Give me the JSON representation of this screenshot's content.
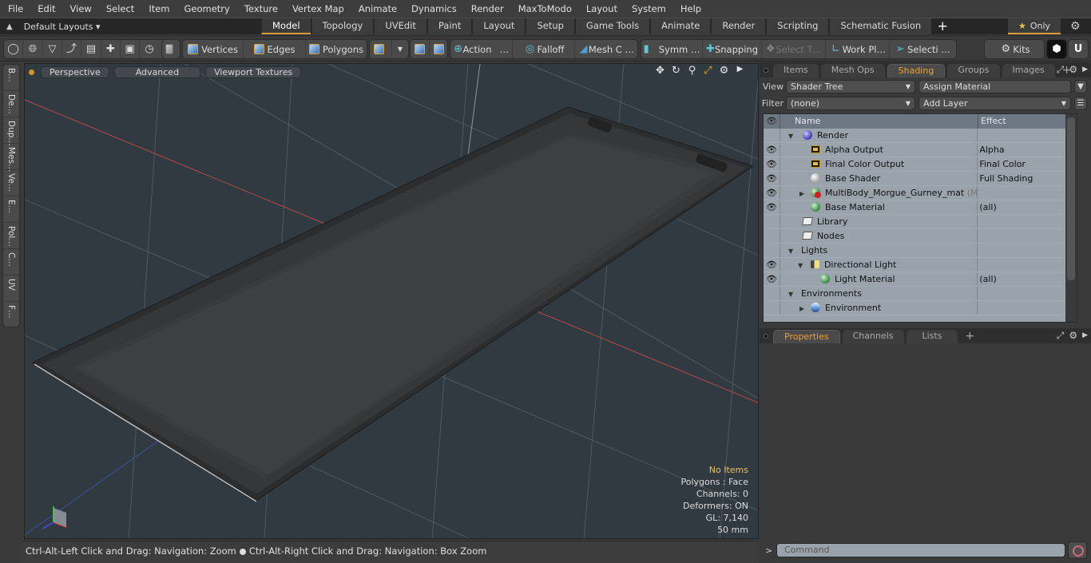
{
  "menu": [
    "File",
    "Edit",
    "View",
    "Select",
    "Item",
    "Geometry",
    "Texture",
    "Vertex Map",
    "Animate",
    "Dynamics",
    "Render",
    "MaxToModo",
    "Layout",
    "System",
    "Help"
  ],
  "layouts": {
    "label": "Default Layouts ▾",
    "tabs": [
      "Model",
      "Topology",
      "UVEdit",
      "Paint",
      "Layout",
      "Setup",
      "Game Tools",
      "Animate",
      "Render",
      "Scripting",
      "Schematic Fusion"
    ],
    "active_tab": "Model",
    "add_label": "+",
    "only_label": "Only"
  },
  "toolbar": {
    "vertices": "Vertices",
    "edges": "Edges",
    "polygons": "Polygons",
    "action": "Action",
    "falloff": "Falloff",
    "mesh_c": "Mesh C …",
    "symm": "Symm …",
    "snapping": "Snapping",
    "select_t": "Select T…",
    "work_pl": "Work Pl…",
    "selecti": "Selecti …",
    "kits": "Kits",
    "ellipsis": "…"
  },
  "left_tools": [
    "B…",
    "De…",
    "Dup…",
    "Mes…",
    "Ve…",
    "E…",
    "Pol…",
    "C…",
    "UV",
    "F…"
  ],
  "viewport": {
    "buttons": [
      "Perspective",
      "Advanced",
      "Viewport Textures"
    ],
    "info": {
      "items": "No Items",
      "polygons": "Polygons : Face",
      "channels": "Channels: 0",
      "deformers": "Deformers: ON",
      "gl": "GL: 7,140",
      "scale": "50 mm"
    }
  },
  "status": {
    "left": "Ctrl-Alt-Left Click and Drag: Navigation: Zoom",
    "right": "Ctrl-Alt-Right Click and Drag: Navigation: Box Zoom"
  },
  "top_panel": {
    "tabs": [
      "Items",
      "Mesh Ops",
      "Shading",
      "Groups",
      "Images"
    ],
    "active_tab": "Shading",
    "view_label": "View",
    "view_value": "Shader Tree",
    "assign_material": "Assign Material",
    "filter_label": "Filter",
    "filter_value": "(none)",
    "add_layer": "Add Layer",
    "columns": {
      "name": "Name",
      "effect": "Effect"
    },
    "rows": [
      {
        "name": "Render",
        "effect": "",
        "eye": false,
        "icon": "render-sphere-icon"
      },
      {
        "name": "Alpha Output",
        "effect": "Alpha",
        "eye": true,
        "icon": "image-output-icon"
      },
      {
        "name": "Final Color Output",
        "effect": "Final Color",
        "eye": true,
        "icon": "image-output-icon"
      },
      {
        "name": "Base Shader",
        "effect": "Full Shading",
        "eye": true,
        "icon": "shader-sphere-icon"
      },
      {
        "name": "MultiBody_Morgue_Gurney_mat",
        "suffix": "(Ma…",
        "effect": "",
        "eye": true,
        "icon": "material-mask-icon"
      },
      {
        "name": "Base Material",
        "effect": "(all)",
        "eye": true,
        "icon": "material-sphere-icon"
      },
      {
        "name": "Library",
        "effect": "",
        "eye": false,
        "icon": "folder-icon"
      },
      {
        "name": "Nodes",
        "effect": "",
        "eye": false,
        "icon": "folder-icon"
      },
      {
        "name": "Lights",
        "effect": "",
        "eye": false,
        "icon": ""
      },
      {
        "name": "Directional Light",
        "effect": "",
        "eye": true,
        "icon": "directional-light-icon"
      },
      {
        "name": "Light Material",
        "effect": "(all)",
        "eye": true,
        "icon": "material-sphere-icon"
      },
      {
        "name": "Environments",
        "effect": "",
        "eye": false,
        "icon": ""
      },
      {
        "name": "Environment",
        "effect": "",
        "eye": false,
        "icon": "environment-sphere-icon"
      }
    ]
  },
  "bottom_panel": {
    "tabs": [
      "Properties",
      "Channels",
      "Lists"
    ],
    "active_tab": "Properties"
  },
  "command": {
    "prompt": ">",
    "placeholder": "Command"
  }
}
